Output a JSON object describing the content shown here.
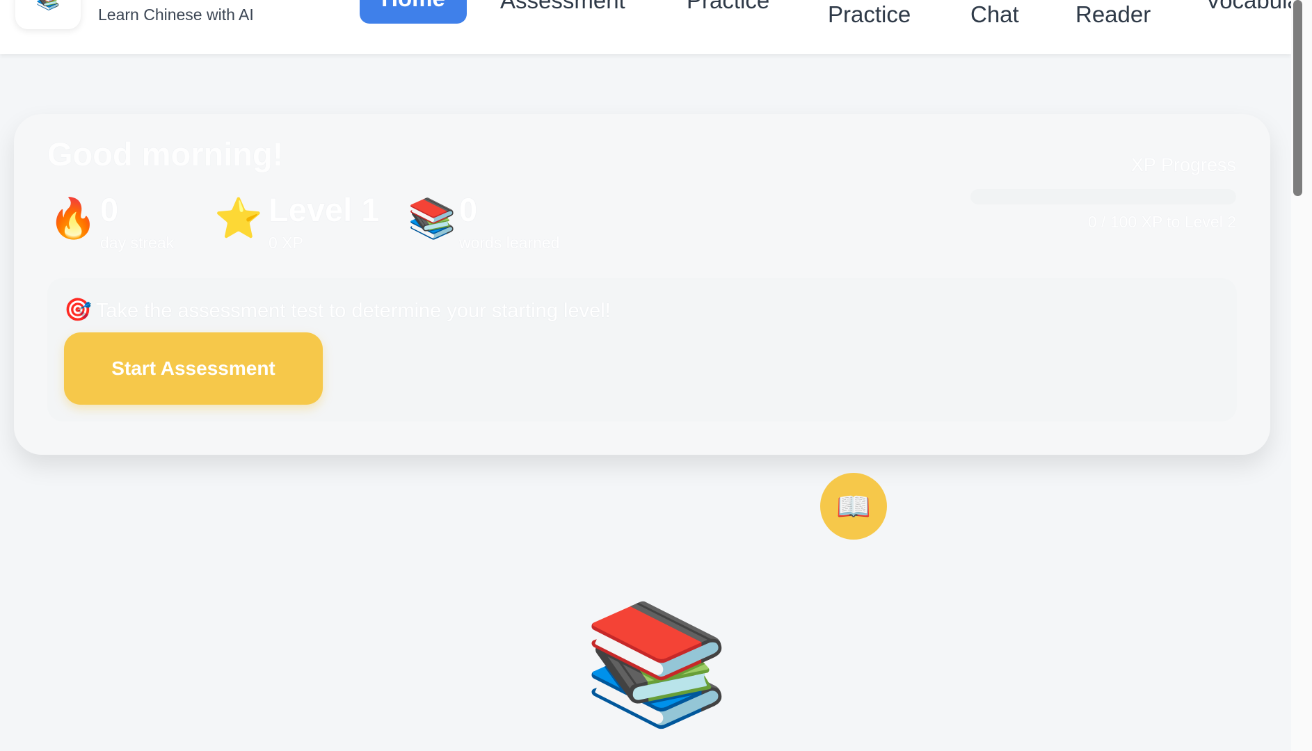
{
  "header": {
    "logo_icon": "📚",
    "tagline": "Learn Chinese with AI",
    "nav": {
      "home": "Home",
      "assessment": "Assessment",
      "practice": "Practice",
      "practice2": "Practice",
      "chat": "Chat",
      "reader": "Reader",
      "vocabulary": "Vocabula"
    }
  },
  "hero": {
    "greeting": "Good morning!",
    "stats": [
      {
        "icon": "🔥",
        "value": "0",
        "label": "day streak"
      },
      {
        "icon": "⭐",
        "value": "Level 1",
        "label": "0 XP"
      },
      {
        "icon": "📚",
        "value": "0",
        "label": "words learned"
      }
    ],
    "xp": {
      "title": "XP Progress",
      "text": "0 / 100 XP to Level 2",
      "progress_fraction": 0
    },
    "assessment": {
      "icon": "🎯",
      "message": "Take the assessment test to determine your starting level!",
      "button": "Start Assessment"
    }
  },
  "fab_icon": "📖",
  "hero_image_icon": "📚",
  "colors": {
    "accent_blue": "#3f80ea",
    "accent_yellow": "#f6c84a",
    "background": "#f4f6f8"
  }
}
